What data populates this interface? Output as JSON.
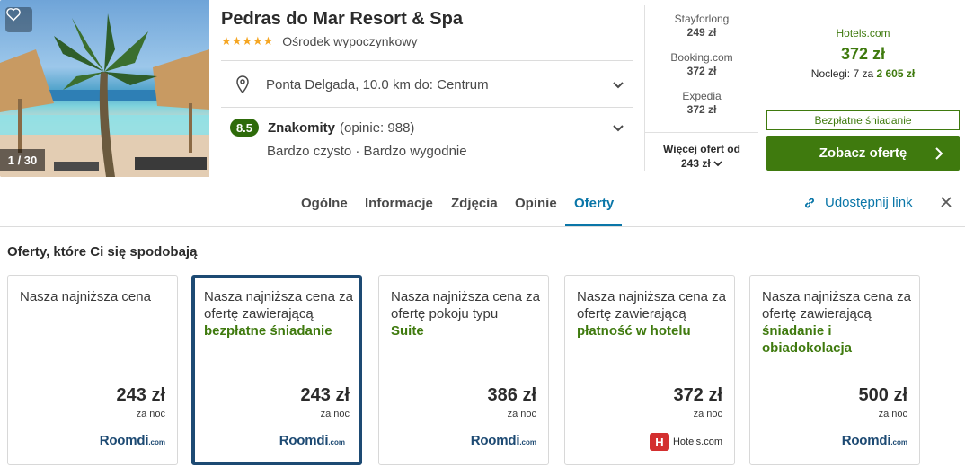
{
  "hotel": {
    "name": "Pedras do Mar Resort & Spa",
    "stars": "★★★★★",
    "category": "Ośrodek wypoczynkowy",
    "photo_counter": "1 / 30",
    "location": "Ponta Delgada, 10.0 km do: Centrum",
    "rating_score": "8.5",
    "rating_label": "Znakomity",
    "rating_count": "(opinie: 988)",
    "rating_sub": "Bardzo czysto · Bardzo wygodnie"
  },
  "price_providers": [
    {
      "name": "Stayforlong",
      "price": "249 zł"
    },
    {
      "name": "Booking.com",
      "price": "372 zł"
    },
    {
      "name": "Expedia",
      "price": "372 zł"
    }
  ],
  "more_offers": {
    "label": "Więcej ofert od",
    "price": "243 zł"
  },
  "best_offer": {
    "provider": "Hotels.com",
    "price": "372 zł",
    "nights_text": "Noclegi: 7 za",
    "total": "2 605 zł",
    "free_breakfast": "Bezpłatne śniadanie",
    "cta": "Zobacz ofertę"
  },
  "tabs": [
    {
      "label": "Ogólne"
    },
    {
      "label": "Informacje"
    },
    {
      "label": "Zdjęcia"
    },
    {
      "label": "Opinie"
    },
    {
      "label": "Oferty"
    }
  ],
  "share_label": "Udostępnij link",
  "offers_title": "Oferty, które Ci się spodobają",
  "offers": [
    {
      "desc": "Nasza najniższa cena",
      "highlight": "",
      "price": "243 zł",
      "per": "za noc",
      "logo": "Roomdi",
      "logo_suffix": ".com"
    },
    {
      "desc": "Nasza najniższa cena za ofertę zawierającą",
      "highlight": "bezpłatne śniadanie",
      "price": "243 zł",
      "per": "za noc",
      "logo": "Roomdi",
      "logo_suffix": ".com"
    },
    {
      "desc": "Nasza najniższa cena za ofertę pokoju typu",
      "highlight": "Suite",
      "price": "386 zł",
      "per": "za noc",
      "logo": "Roomdi",
      "logo_suffix": ".com"
    },
    {
      "desc": "Nasza najniższa cena za ofertę zawierającą",
      "highlight": "płatność w hotelu",
      "price": "372 zł",
      "per": "za noc",
      "logo": "Hotels.com",
      "logo_suffix": ""
    },
    {
      "desc": "Nasza najniższa cena za ofertę zawierającą",
      "highlight": "śniadanie i obiadokolacja",
      "price": "500 zł",
      "per": "za noc",
      "logo": "Roomdi",
      "logo_suffix": ".com"
    }
  ],
  "colors": {
    "green": "#3f7a0e",
    "blue": "#0a76a8",
    "navy": "#1d4a73"
  }
}
